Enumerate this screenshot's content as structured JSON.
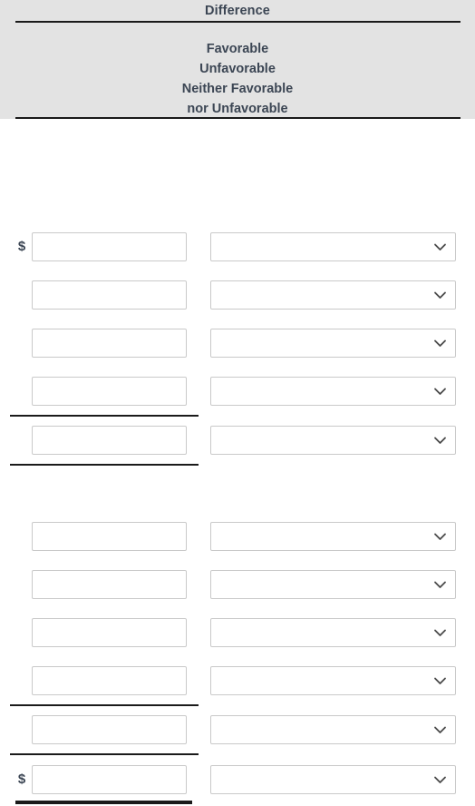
{
  "header": {
    "title": "Difference",
    "category_lines": [
      "Favorable",
      "Unfavorable",
      "Neither Favorable",
      "nor Unfavorable"
    ],
    "background_color": "#e3e3e3",
    "text_color": "#3c4654",
    "rule_color": "#1a1a1a"
  },
  "form": {
    "currency_symbol": "$",
    "input_placeholder": "",
    "select_placeholder": "",
    "dropdown_icon": "chevron-down-icon",
    "rows": [
      {
        "index": 1,
        "has_currency": true,
        "amount": "",
        "choice": ""
      },
      {
        "index": 2,
        "has_currency": false,
        "amount": "",
        "choice": ""
      },
      {
        "index": 3,
        "has_currency": false,
        "amount": "",
        "choice": ""
      },
      {
        "index": 4,
        "has_currency": false,
        "amount": "",
        "choice": ""
      },
      {
        "index": 5,
        "has_currency": false,
        "amount": "",
        "choice": ""
      },
      {
        "index": 6,
        "has_currency": false,
        "amount": "",
        "choice": ""
      },
      {
        "index": 7,
        "has_currency": false,
        "amount": "",
        "choice": ""
      },
      {
        "index": 8,
        "has_currency": false,
        "amount": "",
        "choice": ""
      },
      {
        "index": 9,
        "has_currency": false,
        "amount": "",
        "choice": ""
      },
      {
        "index": 10,
        "has_currency": false,
        "amount": "",
        "choice": ""
      },
      {
        "index": 11,
        "has_currency": true,
        "amount": "",
        "choice": ""
      }
    ],
    "select_options": [
      "Favorable",
      "Unfavorable",
      "Neither Favorable nor Unfavorable"
    ],
    "input_border_color": "#c9c9c9",
    "input_background_color": "#ffffff"
  }
}
